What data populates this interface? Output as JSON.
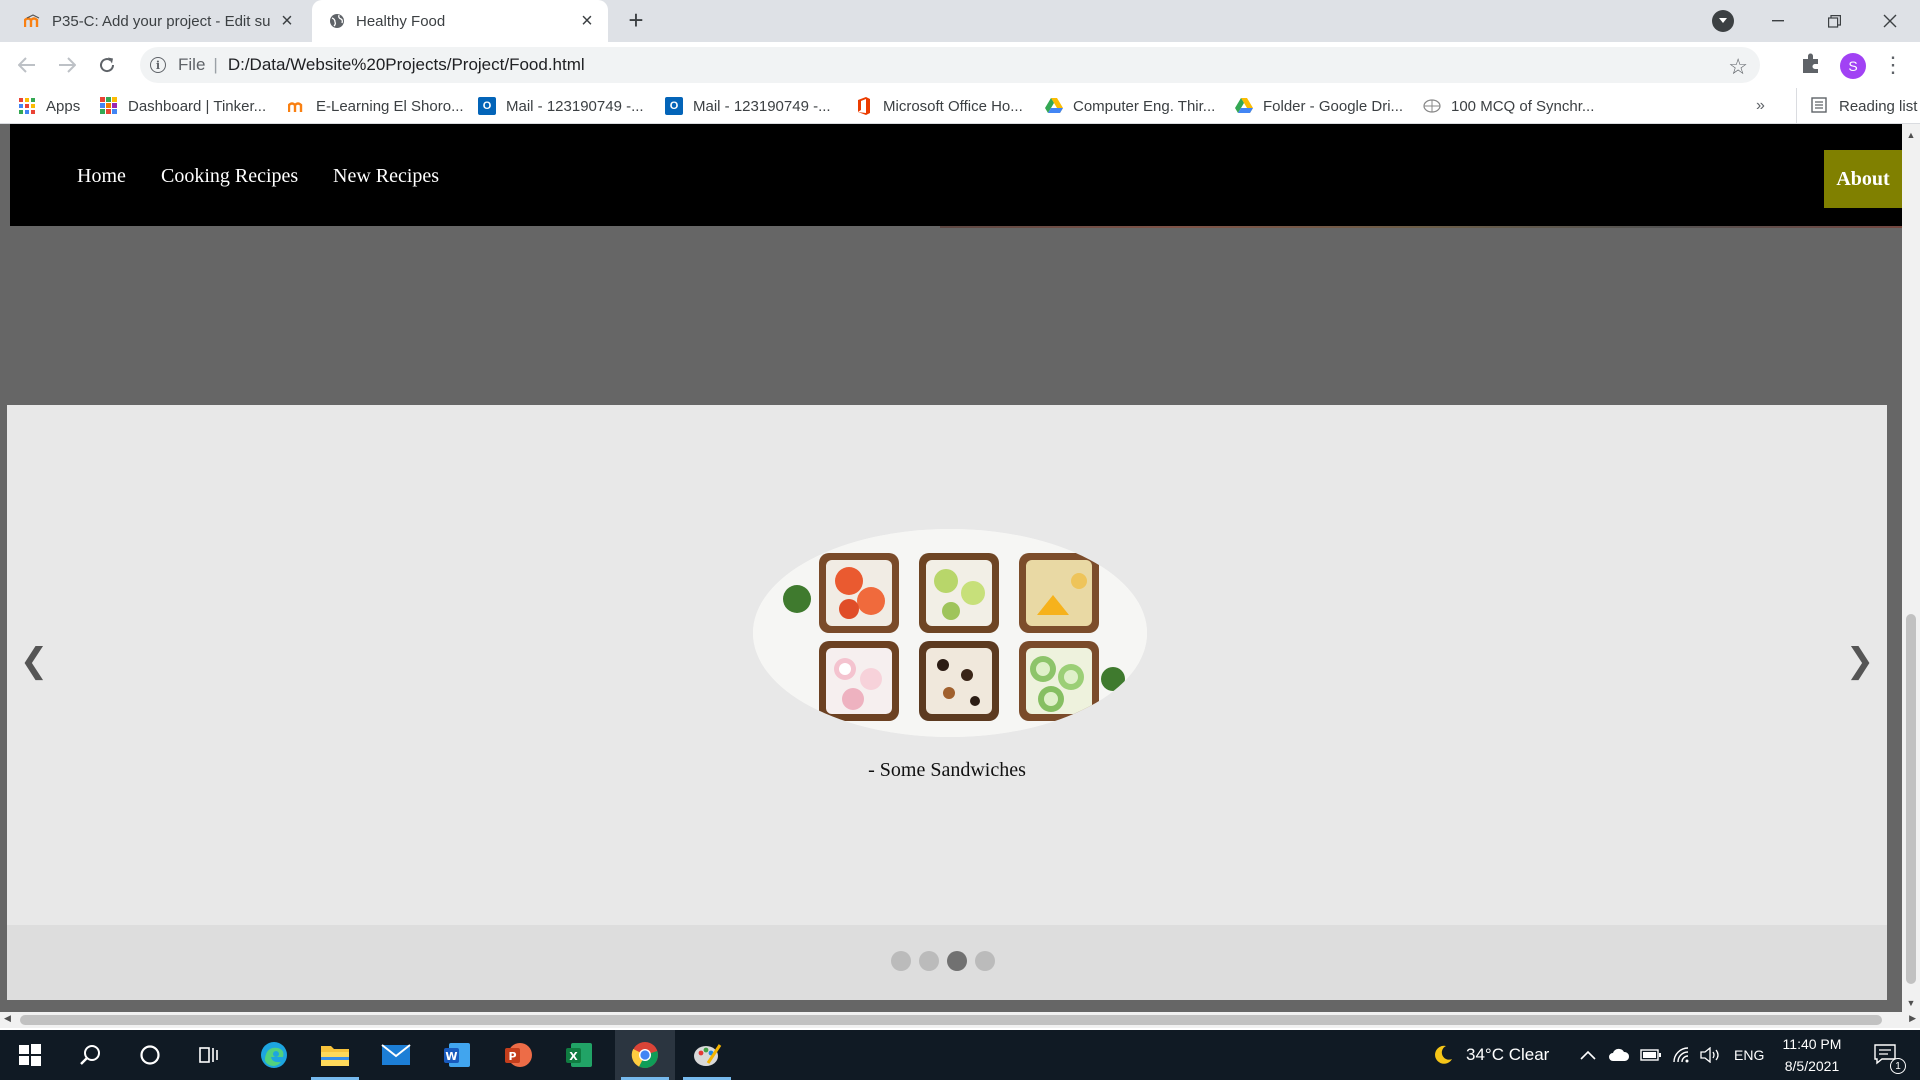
{
  "browser": {
    "tabs": [
      {
        "title": "P35-C: Add your project - Edit su",
        "active": false,
        "favicon": "moodle-icon"
      },
      {
        "title": "Healthy Food",
        "active": true,
        "favicon": "globe-icon"
      }
    ],
    "address": {
      "scheme": "File",
      "url": "D:/Data/Website%20Projects/Project/Food.html"
    },
    "profile_initial": "S",
    "bookmarks": [
      {
        "label": "Apps",
        "icon": "apps-grid-icon"
      },
      {
        "label": "Dashboard | Tinker...",
        "icon": "tinkercad-icon"
      },
      {
        "label": "E-Learning El Shoro...",
        "icon": "moodle-icon"
      },
      {
        "label": "Mail - 123190749 -...",
        "icon": "outlook-icon"
      },
      {
        "label": "Mail - 123190749 -...",
        "icon": "outlook-icon"
      },
      {
        "label": "Microsoft Office Ho...",
        "icon": "office-icon"
      },
      {
        "label": "Computer Eng. Thir...",
        "icon": "google-drive-icon"
      },
      {
        "label": "Folder - Google Dri...",
        "icon": "google-drive-icon"
      },
      {
        "label": "100 MCQ of Synchr...",
        "icon": "globe-icon"
      }
    ],
    "bookmarks_more": "»",
    "reading_list": "Reading list"
  },
  "site": {
    "nav": [
      "Home",
      "Cooking Recipes",
      "New Recipes"
    ],
    "about": "About",
    "slideshow": {
      "caption": "- Some Sandwiches",
      "prev": "❮",
      "next": "❯",
      "slide_count": 4,
      "active_slide": 3
    }
  },
  "taskbar": {
    "apps": [
      "start-icon",
      "search-icon",
      "cortana-icon",
      "task-view-icon",
      "edge-icon",
      "file-explorer-icon",
      "mail-icon",
      "word-icon",
      "powerpoint-icon",
      "excel-icon",
      "chrome-icon",
      "paint-icon"
    ],
    "weather": "34°C  Clear",
    "language": "ENG",
    "time": "11:40 PM",
    "date": "8/5/2021",
    "notifications": "1"
  },
  "colors": {
    "nav_bg": "#000000",
    "about_bg": "#808000",
    "page_bg": "#666666",
    "slide_bg": "#e8e8e8"
  }
}
